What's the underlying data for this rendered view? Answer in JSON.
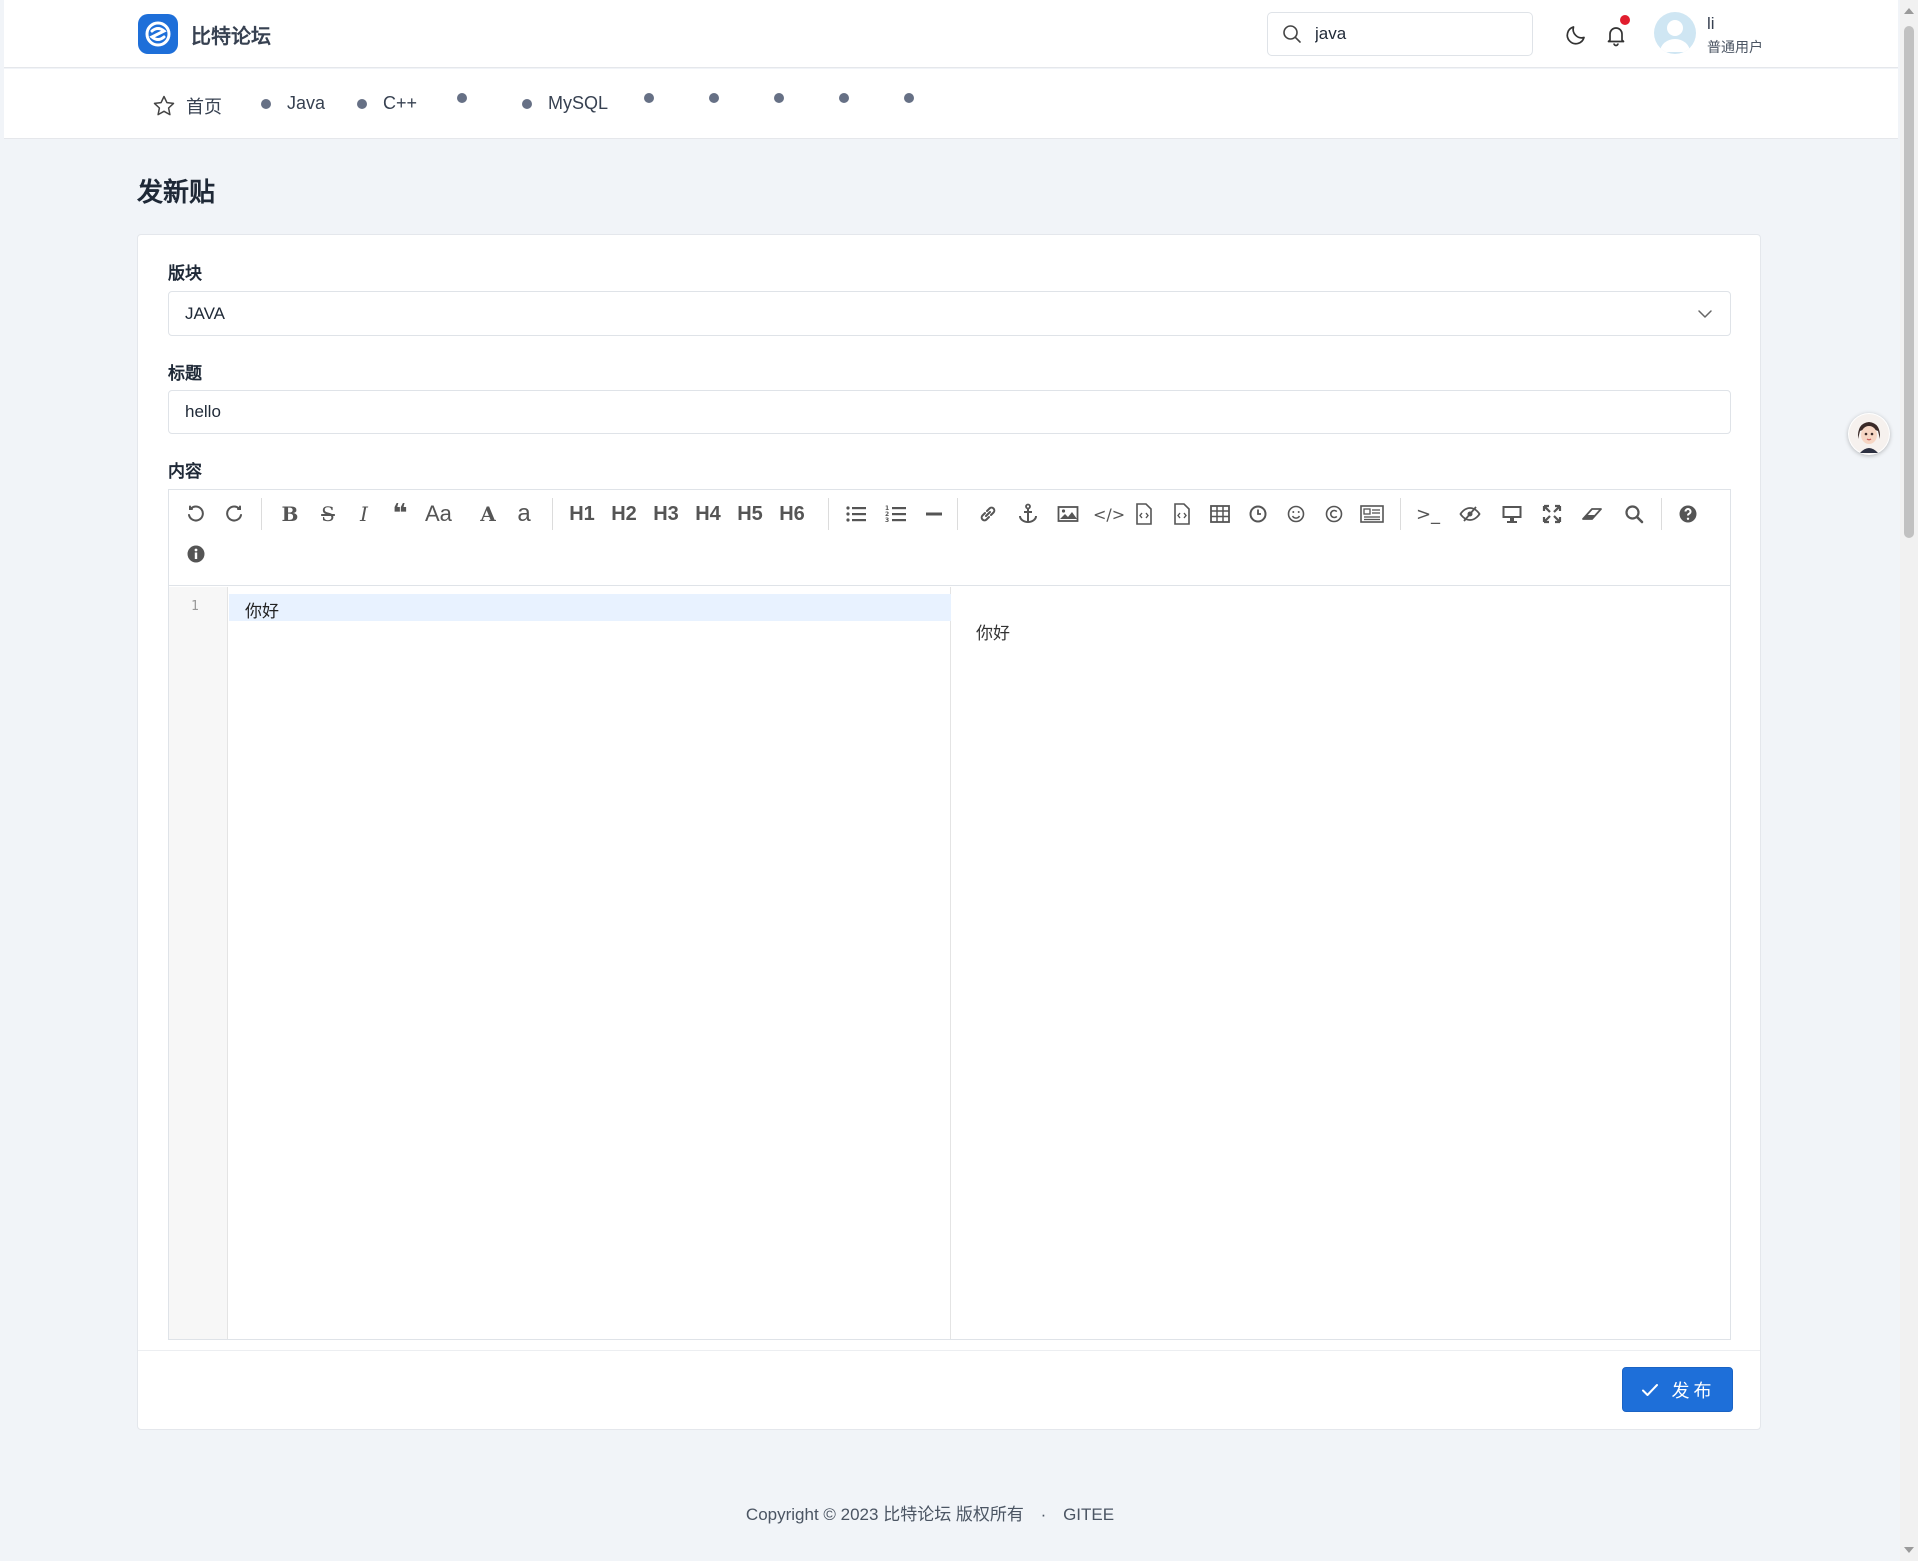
{
  "header": {
    "brand_name": "比特论坛",
    "search_value": "java",
    "user_name": "li",
    "user_role": "普通用户"
  },
  "nav": {
    "home_label": "首页",
    "items": [
      "Java",
      "C++",
      "",
      "MySQL",
      "",
      "",
      "",
      "",
      ""
    ]
  },
  "page_title": "发新贴",
  "form": {
    "board_label": "版块",
    "board_value": "JAVA",
    "title_label": "标题",
    "title_value": "hello",
    "content_label": "内容"
  },
  "editor": {
    "toolbar_headings": [
      "H1",
      "H2",
      "H3",
      "H4",
      "H5",
      "H6"
    ],
    "line_number": "1",
    "code_text": "你好",
    "preview_text": "你好"
  },
  "publish_label": "发布",
  "footer": {
    "copyright": "Copyright © 2023 比特论坛 版权所有",
    "separator": "·",
    "link": "GITEE"
  },
  "colors": {
    "primary": "#1e6fd9",
    "background": "#f1f4f8",
    "notification_dot": "#e11d2e",
    "active_line": "#e8f2ff"
  },
  "icons": [
    "logo-icon",
    "search-icon",
    "moon-icon",
    "bell-icon",
    "user-avatar-icon",
    "star-icon",
    "undo-icon",
    "redo-icon",
    "bold-icon",
    "strikethrough-icon",
    "italic-icon",
    "quote-icon",
    "case-icon",
    "uppercase-icon",
    "lowercase-icon",
    "unordered-list-icon",
    "ordered-list-icon",
    "horizontal-rule-icon",
    "link-icon",
    "anchor-icon",
    "image-icon",
    "code-icon",
    "code-block-icon",
    "code-block-alt-icon",
    "table-icon",
    "clock-icon",
    "emoji-icon",
    "copyright-icon",
    "html-entities-icon",
    "terminal-icon",
    "watch-icon",
    "preview-icon",
    "fullscreen-icon",
    "clear-icon",
    "search-replace-icon",
    "help-icon",
    "info-icon",
    "check-icon",
    "chevron-down-icon"
  ]
}
